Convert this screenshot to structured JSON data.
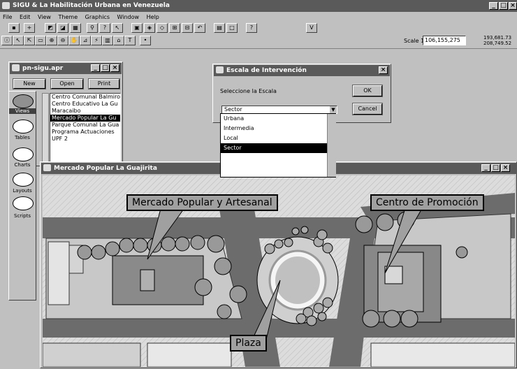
{
  "app": {
    "title": "SIGU & La Habilitación Urbana en Venezuela"
  },
  "menu": [
    "File",
    "Edit",
    "View",
    "Theme",
    "Graphics",
    "Window",
    "Help"
  ],
  "toolbar": {
    "v_label": "V",
    "scale_label": "Scale 1:",
    "scale_value": "106,155,275",
    "coord_x": "193,681.73",
    "coord_y": "208,749.52"
  },
  "project": {
    "title": "pn-sigu.apr",
    "buttons": {
      "new": "New",
      "open": "Open",
      "print": "Print"
    },
    "categories": [
      "Views",
      "Tables",
      "Charts",
      "Layouts",
      "Scripts"
    ],
    "views": [
      "Centro Comunal Balmiro",
      "Centro Educativo La Gu",
      "Maracaibo",
      "Mercado Popular La Gu",
      "Parque Comunal La Gua",
      "Programa Actuaciones",
      "UPF 2"
    ],
    "selected_view": "Mercado Popular La Gu"
  },
  "dialog": {
    "title": "Escala de Intervención",
    "prompt": "Seleccione la Escala",
    "ok": "OK",
    "cancel": "Cancel",
    "selected": "Sector",
    "options": [
      "Urbana",
      "Intermedia",
      "Local",
      "Sector"
    ]
  },
  "view": {
    "title": "Mercado Popular La Guajirita",
    "labels": {
      "mercado": "Mercado Popular y Artesanal",
      "centro": "Centro de Promoción",
      "plaza": "Plaza"
    }
  },
  "colors": {
    "titlebar": "#5a5a5a",
    "chrome": "#c0c0c0",
    "selection": "#000000"
  }
}
